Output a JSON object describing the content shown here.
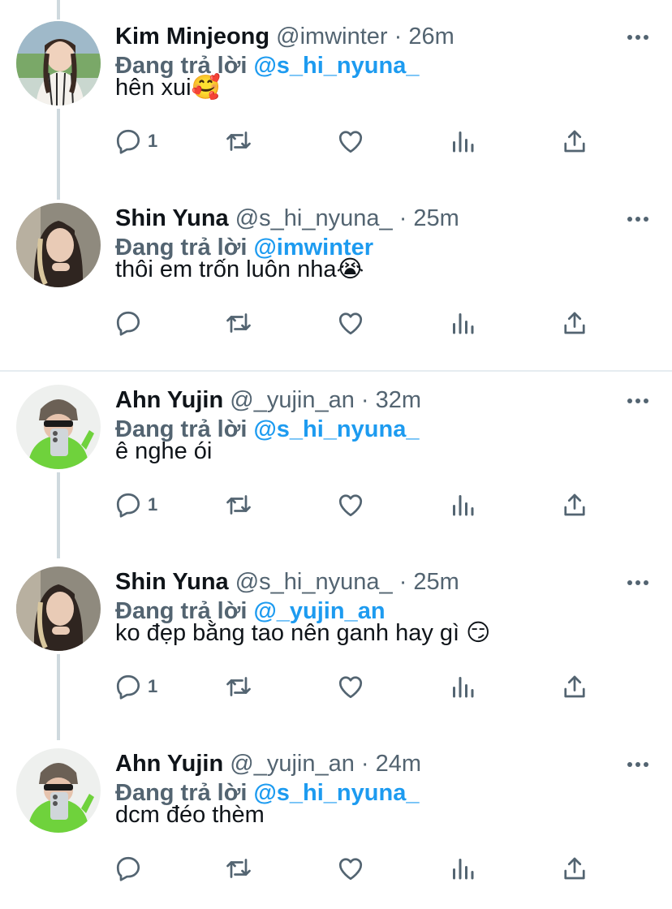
{
  "colors": {
    "accent": "#1d9bf0",
    "meta": "#536471",
    "text": "#0f1419",
    "thread_line": "#cfd9de",
    "divider": "#e6ecf0"
  },
  "icons": {
    "reply": "reply-icon",
    "retweet": "retweet-icon",
    "like": "heart-icon",
    "views": "views-icon",
    "share": "share-icon",
    "more": "more-icon"
  },
  "tweets": [
    {
      "name": "Kim Minjeong",
      "meta": "@imwinter · 26m",
      "reply_prefix": "Đang trả lời ",
      "reply_to": "@s_hi_nyuna_",
      "text": "hên xui🥰",
      "reply_count": "1"
    },
    {
      "name": "Shin Yuna",
      "meta": "@s_hi_nyuna_ · 25m",
      "reply_prefix": "Đang trả lời ",
      "reply_to": "@imwinter",
      "text": "thôi em trốn luôn nha😭",
      "reply_count": ""
    },
    {
      "name": "Ahn Yujin",
      "meta": "@_yujin_an · 32m",
      "reply_prefix": "Đang trả lời ",
      "reply_to": "@s_hi_nyuna_",
      "text": "ê nghe ói",
      "reply_count": "1"
    },
    {
      "name": "Shin Yuna",
      "meta": "@s_hi_nyuna_ · 25m",
      "reply_prefix": "Đang trả lời ",
      "reply_to": "@_yujin_an",
      "text": "ko đẹp bằng tao nên ganh hay gì 😏",
      "reply_count": "1"
    },
    {
      "name": "Ahn Yujin",
      "meta": "@_yujin_an · 24m",
      "reply_prefix": "Đang trả lời ",
      "reply_to": "@s_hi_nyuna_",
      "text": "dcm đéo thèm",
      "reply_count": ""
    }
  ]
}
